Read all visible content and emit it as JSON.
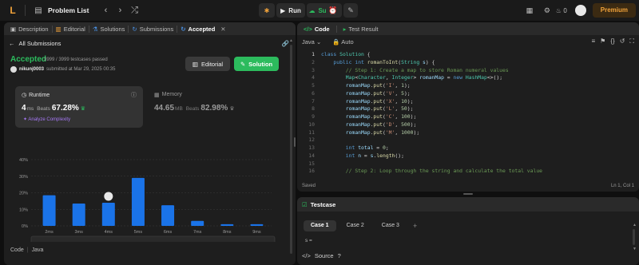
{
  "topbar": {
    "logo": "L",
    "problem_list": "Problem List",
    "run": "Run",
    "submit": "Submit",
    "streak": "0",
    "premium": "Premium"
  },
  "left_tabs": [
    {
      "icon": "description-icon",
      "label": "Description"
    },
    {
      "icon": "editorial-icon",
      "label": "Editorial"
    },
    {
      "icon": "solutions-icon",
      "label": "Solutions"
    },
    {
      "icon": "submissions-icon",
      "label": "Submissions"
    },
    {
      "icon": "accepted-icon",
      "label": "Accepted"
    }
  ],
  "submission": {
    "back_label": "All Submissions",
    "status": "Accepted",
    "testcases": "3999 / 3999 testcases passed",
    "user": "nikunj0003",
    "submitted_at": "submitted at Mar 29, 2025 00:35",
    "editorial_button": "Editorial",
    "solution_button": "Solution"
  },
  "runtime": {
    "title": "Runtime",
    "value": "4",
    "unit": "ms",
    "beats_label": "Beats",
    "beats_pct": "67.28%",
    "analyze": "Analyze Complexity"
  },
  "memory": {
    "title": "Memory",
    "value": "44.65",
    "unit": "MB",
    "beats_label": "Beats",
    "beats_pct": "82.98%"
  },
  "chart_data": {
    "type": "bar",
    "categories": [
      "2ms",
      "3ms",
      "4ms",
      "5ms",
      "6ms",
      "7ms",
      "8ms",
      "9ms"
    ],
    "values": [
      18.5,
      13.5,
      14,
      29,
      12.5,
      3,
      1,
      1
    ],
    "yticks": [
      "40%",
      "30%",
      "20%",
      "10%",
      "0%"
    ],
    "ylim": [
      0,
      40
    ],
    "highlight": "4ms",
    "bar_color": "#1a73e8",
    "minimap_labels": [
      "2ms",
      "3ms",
      "4ms",
      "5ms",
      "6ms",
      "7ms",
      "8ms",
      "9ms"
    ]
  },
  "code_footer": {
    "label": "Code",
    "lang": "Java"
  },
  "editor": {
    "tab_code": "Code",
    "tab_test_result": "Test Result",
    "language": "Java",
    "auto": "Auto",
    "saved": "Saved",
    "position": "Ln 1, Col 1",
    "lines": [
      "class Solution {",
      "    public int romanToInt(String s) {",
      "        // Step 1: Create a map to store Roman numeral values",
      "        Map<Character, Integer> romanMap = new HashMap<>();",
      "        romanMap.put('I', 1);",
      "        romanMap.put('V', 5);",
      "        romanMap.put('X', 10);",
      "        romanMap.put('L', 50);",
      "        romanMap.put('C', 100);",
      "        romanMap.put('D', 500);",
      "        romanMap.put('M', 1000);",
      "",
      "        int total = 0;",
      "        int n = s.length();",
      "",
      "        // Step 2: Loop through the string and calculate the total value"
    ]
  },
  "testcase": {
    "title": "Testcase",
    "cases": [
      "Case 1",
      "Case 2",
      "Case 3"
    ],
    "add": "+",
    "s_label": "s =",
    "source": "Source"
  },
  "colors": {
    "accent_green": "#2cbb5d",
    "accent_orange": "#f2a33a",
    "bar_blue": "#1a73e8",
    "purple": "#a477f2"
  }
}
